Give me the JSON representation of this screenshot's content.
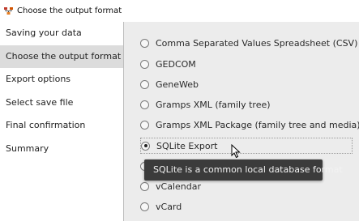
{
  "window": {
    "title": "Choose the output format",
    "icon": "gramps-app-icon"
  },
  "sidebar": {
    "items": [
      {
        "label": "Saving your data"
      },
      {
        "label": "Choose the output format",
        "active": true
      },
      {
        "label": "Export options"
      },
      {
        "label": "Select save file"
      },
      {
        "label": "Final confirmation"
      },
      {
        "label": "Summary"
      }
    ]
  },
  "formats": {
    "options": [
      {
        "label": "Comma Separated Values Spreadsheet (CSV)",
        "selected": false
      },
      {
        "label": "GEDCOM",
        "selected": false
      },
      {
        "label": "GeneWeb",
        "selected": false
      },
      {
        "label": "Gramps XML (family tree)",
        "selected": false
      },
      {
        "label": "Gramps XML Package (family tree and media)",
        "selected": false
      },
      {
        "label": "SQLite Export",
        "selected": true
      },
      {
        "label": "",
        "selected": false
      },
      {
        "label": "vCalendar",
        "selected": false
      },
      {
        "label": "vCard",
        "selected": false
      }
    ]
  },
  "tooltip": {
    "text": "SQLite is a common local database format"
  },
  "cursor": {
    "icon": "pointer-arrow-icon"
  }
}
